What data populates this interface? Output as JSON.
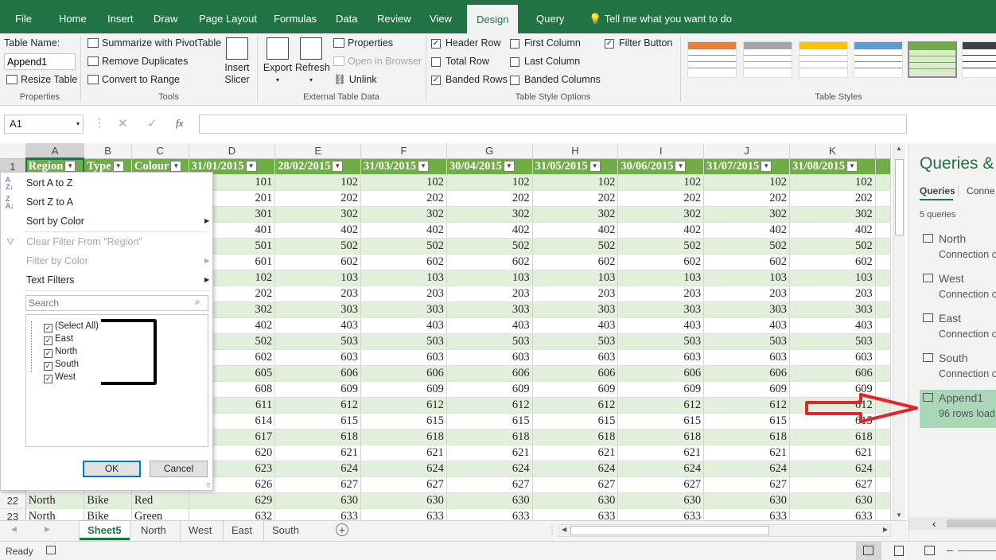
{
  "menu": {
    "tabs": [
      "File",
      "Home",
      "Insert",
      "Draw",
      "Page Layout",
      "Formulas",
      "Data",
      "Review",
      "View",
      "Design",
      "Query"
    ],
    "active": "Design",
    "tellme": "Tell me what you want to do"
  },
  "ribbon": {
    "properties": {
      "label": "Properties",
      "table_name_label": "Table Name:",
      "table_name_value": "Append1",
      "resize": "Resize Table"
    },
    "tools": {
      "label": "Tools",
      "summarize": "Summarize with PivotTable",
      "remove_dup": "Remove Duplicates",
      "convert": "Convert to Range",
      "insert_slicer": "Insert Slicer"
    },
    "external": {
      "label": "External Table Data",
      "export": "Export",
      "refresh": "Refresh",
      "properties": "Properties",
      "open_browser": "Open in Browser",
      "unlink": "Unlink"
    },
    "style_options": {
      "label": "Table Style Options",
      "header_row": "Header Row",
      "total_row": "Total Row",
      "banded_rows": "Banded Rows",
      "first_column": "First Column",
      "last_column": "Last Column",
      "banded_columns": "Banded Columns",
      "filter_button": "Filter Button"
    },
    "styles": {
      "label": "Table Styles",
      "colors": [
        "#ed7d31",
        "#a5a5a5",
        "#ffc000",
        "#5b9bd5",
        "#70ad47",
        "#404040"
      ]
    }
  },
  "formula_bar": {
    "name_box": "A1",
    "fx": "fx"
  },
  "grid": {
    "columns": [
      "A",
      "B",
      "C",
      "D",
      "E",
      "F",
      "G",
      "H",
      "I",
      "J",
      "K"
    ],
    "header_row": [
      "Region",
      "Type",
      "Colour",
      "31/01/2015",
      "28/02/2015",
      "31/03/2015",
      "30/04/2015",
      "31/05/2015",
      "30/06/2015",
      "31/07/2015",
      "31/08/2015"
    ],
    "d_values": [
      101,
      201,
      301,
      401,
      501,
      601,
      102,
      202,
      302,
      402,
      502,
      602,
      605,
      608,
      611,
      614,
      617,
      620,
      623,
      626,
      629,
      632
    ],
    "row22": {
      "num": "22",
      "region": "North",
      "type": "Bike",
      "colour": "Red"
    },
    "row23": {
      "num": "23",
      "region": "North",
      "type": "Bike",
      "colour": "Green"
    }
  },
  "filter_menu": {
    "sort_az": "Sort A to Z",
    "sort_za": "Sort Z to A",
    "sort_color": "Sort by Color",
    "clear_filter": "Clear Filter From \"Region\"",
    "filter_color": "Filter by Color",
    "text_filters": "Text Filters",
    "search_placeholder": "Search",
    "items": [
      "(Select All)",
      "East",
      "North",
      "South",
      "West"
    ],
    "ok": "OK",
    "cancel": "Cancel"
  },
  "queries_pane": {
    "title": "Queries &",
    "tab_queries": "Queries",
    "tab_conn": "Conne",
    "count": "5 queries",
    "items": [
      {
        "name": "North",
        "sub": "Connection o"
      },
      {
        "name": "West",
        "sub": "Connection o"
      },
      {
        "name": "East",
        "sub": "Connection o"
      },
      {
        "name": "South",
        "sub": "Connection o"
      },
      {
        "name": "Append1",
        "sub": "96 rows load"
      }
    ]
  },
  "sheets": {
    "tabs": [
      "Sheet5",
      "North",
      "West",
      "East",
      "South"
    ],
    "active": "Sheet5"
  },
  "status": {
    "ready": "Ready"
  }
}
